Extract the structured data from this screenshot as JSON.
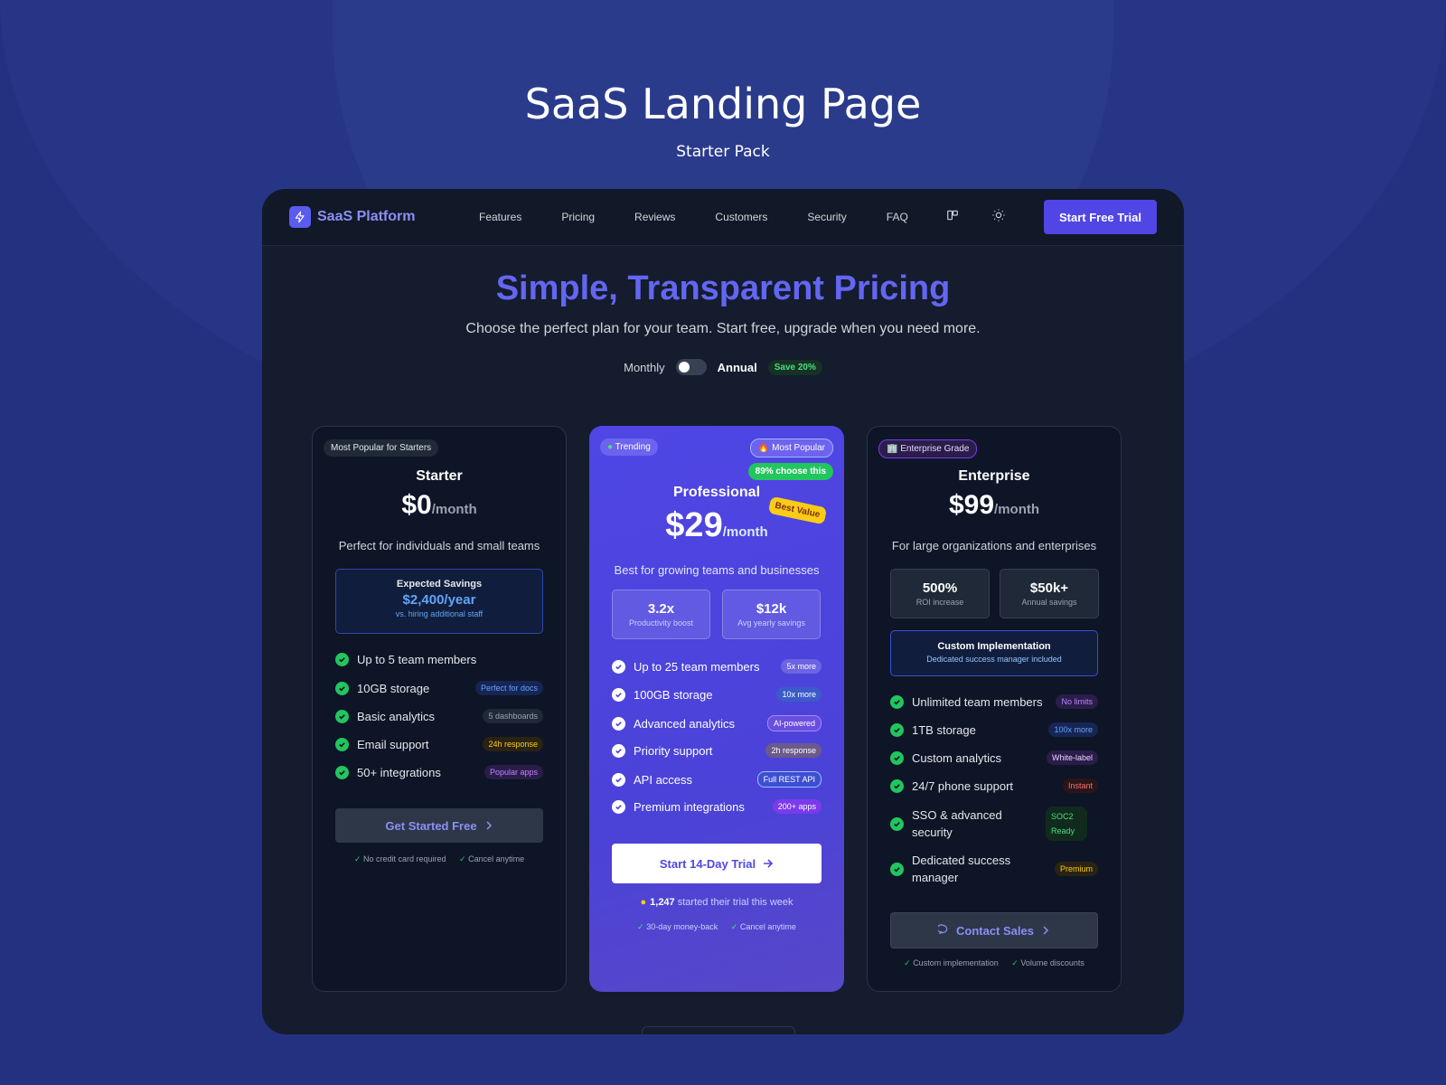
{
  "page": {
    "title": "SaaS Landing Page",
    "subtitle": "Starter Pack"
  },
  "nav": {
    "logo": "SaaS Platform",
    "links": [
      "Features",
      "Pricing",
      "Reviews",
      "Customers",
      "Security",
      "FAQ"
    ],
    "cta": "Start Free Trial",
    "icons": [
      "layout-icon",
      "sun-icon"
    ]
  },
  "header": {
    "title": "Simple, Transparent Pricing",
    "subtitle": "Choose the perfect plan for your team. Start free, upgrade when you need more.",
    "monthly": "Monthly",
    "annual": "Annual",
    "save": "Save 20%"
  },
  "plans": {
    "starter": {
      "tag": "Most Popular for Starters",
      "name": "Starter",
      "price": "$0",
      "per": "/month",
      "desc": "Perfect for individuals and small teams",
      "savings_label": "Expected Savings",
      "savings_value": "$2,400/year",
      "savings_note": "vs. hiring additional staff",
      "features": [
        {
          "text": "Up to 5 team members",
          "pill": ""
        },
        {
          "text": "10GB storage",
          "pill": "Perfect for docs"
        },
        {
          "text": "Basic analytics",
          "pill": "5 dashboards"
        },
        {
          "text": "Email support",
          "pill": "24h response"
        },
        {
          "text": "50+ integrations",
          "pill": "Popular apps"
        }
      ],
      "button": "Get Started Free",
      "fine": [
        "No credit card required",
        "Cancel anytime"
      ]
    },
    "pro": {
      "tag_left": "Trending",
      "tag_right": "🔥 Most Popular",
      "choose": "89% choose this",
      "name": "Professional",
      "price": "$29",
      "per": "/month",
      "ribbon": "Best Value",
      "desc": "Best for growing teams and businesses",
      "stats": [
        {
          "big": "3.2x",
          "small": "Productivity boost"
        },
        {
          "big": "$12k",
          "small": "Avg yearly savings"
        }
      ],
      "features": [
        {
          "text": "Up to 25 team members",
          "pill": "5x more"
        },
        {
          "text": "100GB storage",
          "pill": "10x more"
        },
        {
          "text": "Advanced analytics",
          "pill": "AI-powered"
        },
        {
          "text": "Priority support",
          "pill": "2h response"
        },
        {
          "text": "API access",
          "pill": "Full REST API"
        },
        {
          "text": "Premium integrations",
          "pill": "200+ apps"
        }
      ],
      "button": "Start 14-Day Trial",
      "trial_count": "1,247",
      "trial_text": "started their trial this week",
      "fine": [
        "30-day money-back",
        "Cancel anytime"
      ]
    },
    "enterprise": {
      "tag": "🏢 Enterprise Grade",
      "name": "Enterprise",
      "price": "$99",
      "per": "/month",
      "desc": "For large organizations and enterprises",
      "stats": [
        {
          "big": "500%",
          "small": "ROI increase"
        },
        {
          "big": "$50k+",
          "small": "Annual savings"
        }
      ],
      "impl_title": "Custom Implementation",
      "impl_note": "Dedicated success manager included",
      "features": [
        {
          "text": "Unlimited team members",
          "pill": "No limits"
        },
        {
          "text": "1TB storage",
          "pill": "100x more"
        },
        {
          "text": "Custom analytics",
          "pill": "White-label"
        },
        {
          "text": "24/7 phone support",
          "pill": "Instant"
        },
        {
          "text": "SSO & advanced security",
          "pill": "SOC2 Ready"
        },
        {
          "text": "Dedicated success manager",
          "pill": "Premium"
        }
      ],
      "button": "Contact Sales",
      "fine": [
        "Custom implementation",
        "Volume discounts"
      ]
    }
  }
}
